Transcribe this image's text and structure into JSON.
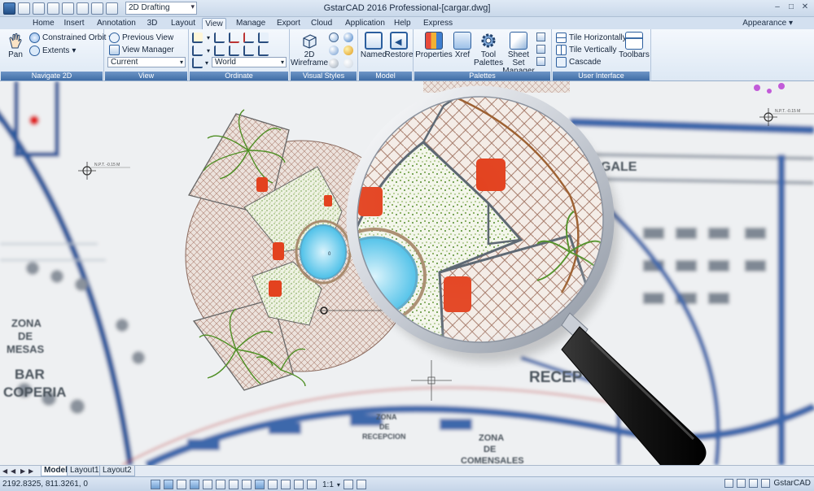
{
  "window": {
    "title": "GstarCAD 2016 Professional-[cargar.dwg]",
    "workspace": "2D Drafting",
    "controls": [
      "–",
      "□",
      "✕"
    ]
  },
  "tabs": [
    "Home",
    "Insert",
    "Annotation",
    "3D",
    "Layout",
    "View",
    "Manage",
    "Export",
    "Cloud",
    "Application",
    "Help",
    "Express"
  ],
  "active_tab": "View",
  "appearance_label": "Appearance",
  "ribbon": {
    "navigate": {
      "title": "Navigate 2D",
      "pan": "Pan",
      "orbit": "Constrained Orbit",
      "extents": "Extents"
    },
    "view": {
      "title": "View",
      "previous": "Previous View",
      "manager": "View Manager",
      "current": "Current"
    },
    "ordinate": {
      "title": "Ordinate",
      "world": "World"
    },
    "visual_styles": {
      "title": "Visual Styles",
      "wireframe_line1": "2D",
      "wireframe_line2": "Wireframe"
    },
    "model_viewports": {
      "title": "Model Viewports",
      "named": "Named",
      "restore": "Restore"
    },
    "palettes": {
      "title": "Palettes",
      "properties": "Properties",
      "xref": "Xref",
      "tool_line1": "Tool",
      "tool_line2": "Palettes",
      "sheet_line1": "Sheet Set",
      "sheet_line2": "Manager"
    },
    "user_interface": {
      "title": "User Interface",
      "tile_h": "Tile Horizontally",
      "tile_v": "Tile Vertically",
      "cascade": "Cascade",
      "toolbars": "Toolbars"
    }
  },
  "drawing": {
    "npt_label": "N.P.T. -0.15 M",
    "npt_label_right": "N.P.T. -0.15 M",
    "zona_mesas_1": "ZONA",
    "zona_mesas_2": "DE",
    "zona_mesas_3": "MESAS",
    "bar": "BAR",
    "coperia": "COPERIA",
    "recep": "RECEP",
    "zona_rec_1": "ZONA",
    "zona_rec_2": "DE",
    "zona_rec_3": "RECEPCION",
    "zona_com_1": "ZONA",
    "zona_com_2": "DE",
    "zona_com_3": "COMENSALES",
    "gale": "GALE",
    "pool_mark": "0"
  },
  "layout_tabs": [
    "Model",
    "Layout1",
    "Layout2"
  ],
  "active_layout": "Model",
  "status": {
    "coords": "2192.8325, 811.3261, 0",
    "scale": "1:1",
    "brand": "GstarCAD"
  }
}
